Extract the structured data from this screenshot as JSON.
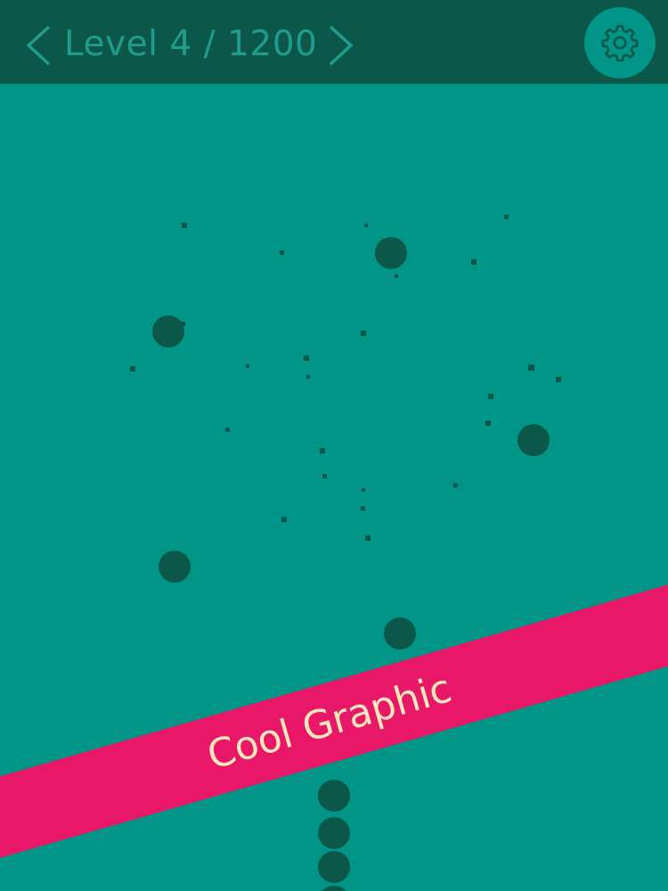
{
  "header": {
    "level_label": "Level 4 / 1200",
    "prev_icon": "chevron-left-icon",
    "next_icon": "chevron-right-icon",
    "settings_icon": "gear-icon"
  },
  "banner": {
    "text": "Cool Graphic"
  },
  "colors": {
    "background": "#009587",
    "top_bar": "#0b5749",
    "dot": "#0b5749",
    "banner": "#e91768",
    "banner_text": "#fce7bd",
    "header_text": "#1f9c8d"
  }
}
